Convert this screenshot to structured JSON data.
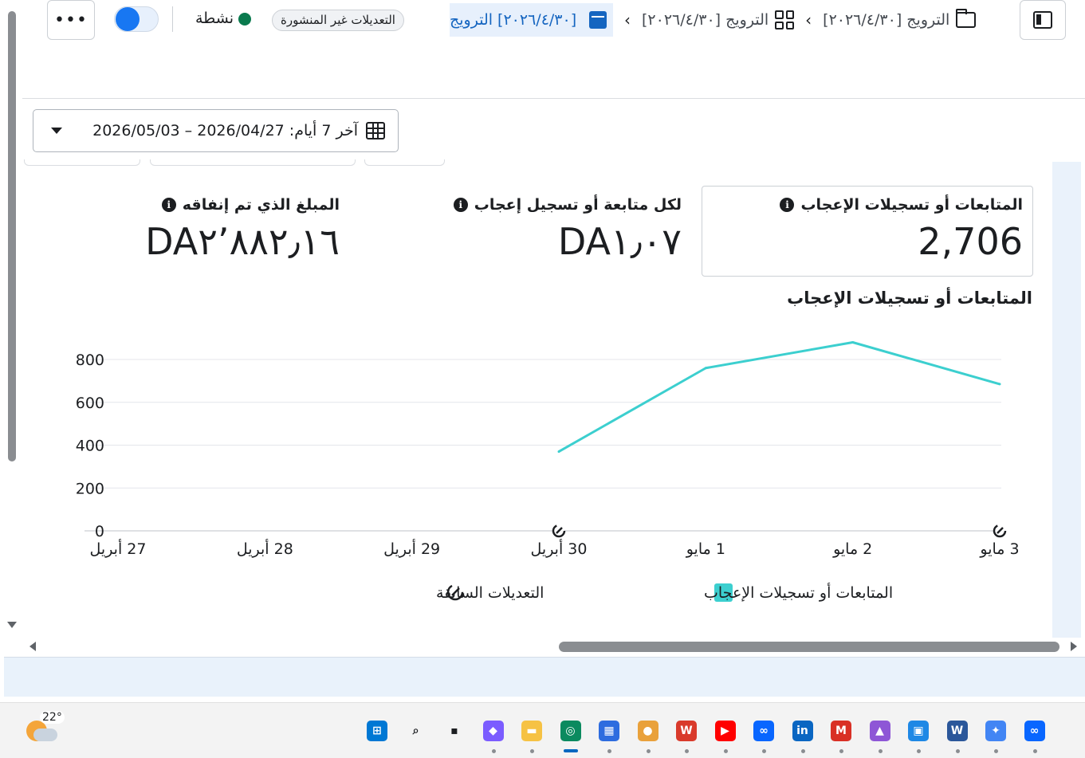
{
  "header": {
    "breadcrumbs": [
      {
        "label": "[٢٠٢٦/٤/٣٠] الترويج",
        "icon": "folder-icon"
      },
      {
        "label": "[٢٠٢٦/٤/٣٠] الترويج",
        "icon": "grid-icon"
      },
      {
        "label": "[٢٠٢٦/٤/٣٠] الترويج",
        "icon": "calendar-icon"
      }
    ],
    "unpublished_badge": "التعديلات غير المنشورة",
    "status": "نشطة",
    "status_color": "#0a7a4e",
    "more_label": "•••",
    "toggle_on": true
  },
  "date_range": {
    "label": "آخر 7 أيام: 2026/04/27 – 2026/05/03"
  },
  "metrics": [
    {
      "label": "المتابعات أو تسجيلات الإعجاب",
      "value": "2,706",
      "selected": true
    },
    {
      "label": "لكل متابعة أو تسجيل إعجاب",
      "value": "DA١٫٠٧"
    },
    {
      "label": "المبلغ الذي تم إنفاقه",
      "value": "DA٢٬٨٨٢٫١٦"
    }
  ],
  "chart_title": "المتابعات أو تسجيلات الإعجاب",
  "chart_data": {
    "type": "line",
    "title": "المتابعات أو تسجيلات الإعجاب",
    "categories": [
      "27 أبريل",
      "28 أبريل",
      "29 أبريل",
      "30 أبريل",
      "1 مايو",
      "2 مايو",
      "3 مايو"
    ],
    "series": [
      {
        "name": "المتابعات أو تسجيلات الإعجاب",
        "color": "#3ccfcf",
        "values": [
          null,
          null,
          null,
          370,
          760,
          880,
          685
        ]
      }
    ],
    "ylim": [
      0,
      800
    ],
    "yticks": [
      0,
      200,
      400,
      600,
      800
    ],
    "grid": true,
    "edit_markers_at": [
      "30 أبريل",
      "3 مايو"
    ],
    "legend": [
      {
        "label": "المتابعات أو تسجيلات الإعجاب",
        "type": "swatch",
        "color": "#3ccfcf"
      },
      {
        "label": "التعديلات السابقة",
        "type": "edit-icon"
      }
    ],
    "legend_position": "bottom"
  },
  "taskbar": {
    "weather_temp": "22°",
    "apps": [
      "start-icon",
      "search-icon",
      "task-view-icon",
      "copilot-icon",
      "file-explorer-icon",
      "edge-icon",
      "store-icon",
      "chrome-icon",
      "wps-icon",
      "youtube-icon",
      "meta-icon",
      "linkedin-icon",
      "gmail-icon",
      "photos-icon",
      "paint-icon",
      "word-icon",
      "gemini-icon",
      "meta-ai-icon"
    ]
  }
}
